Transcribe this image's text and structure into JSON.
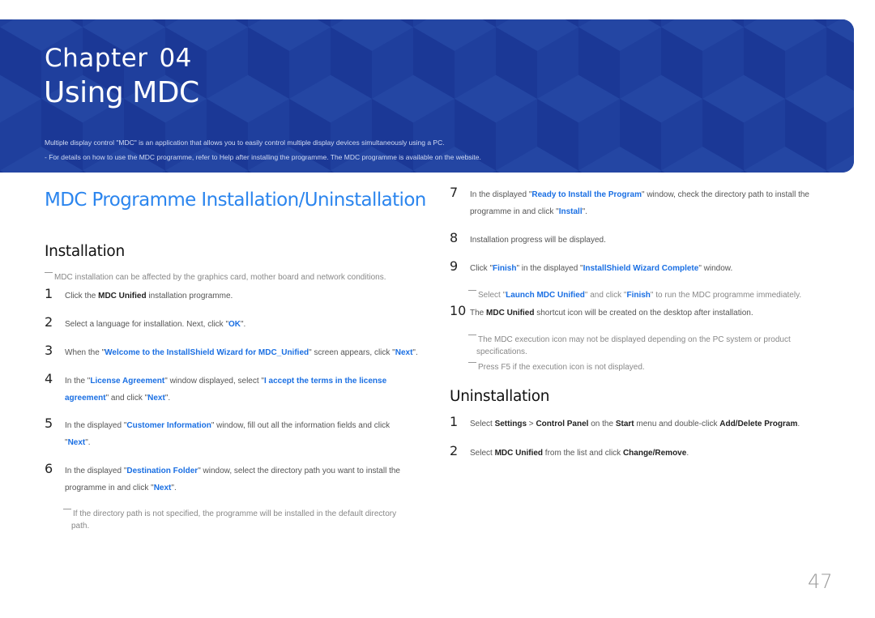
{
  "banner": {
    "chapter_label": "Chapter",
    "chapter_number": "04",
    "title": "Using MDC",
    "intro_line1": "Multiple display control \"MDC\" is an application that allows you to easily control multiple display devices simultaneously using a PC.",
    "intro_line2": "- For details on how to use the MDC programme, refer to Help after installing the programme. The MDC programme is available on the website."
  },
  "section_title": "MDC Programme Installation/Uninstallation",
  "installation": {
    "heading": "Installation",
    "note": "MDC installation can be affected by the graphics card, mother board and network conditions.",
    "steps": [
      {
        "num": "1",
        "parts": [
          "Click the ",
          "MDC Unified",
          " installation programme."
        ]
      },
      {
        "num": "2",
        "parts": [
          "Select a language for installation. Next, click \"",
          "OK",
          "\"."
        ]
      },
      {
        "num": "3",
        "parts": [
          "When the \"",
          "Welcome to the InstallShield Wizard for MDC_Unified",
          "\" screen appears, click \"",
          "Next",
          "\"."
        ]
      },
      {
        "num": "4",
        "parts": [
          "In the \"",
          "License Agreement",
          "\" window displayed, select \"",
          "I accept the terms in the license",
          "agreement",
          "\" and click \"",
          "Next",
          "\"."
        ]
      },
      {
        "num": "5",
        "parts": [
          "In the displayed \"",
          "Customer Information",
          "\" window, fill out all the information fields and click",
          "\"",
          "Next",
          "\"."
        ]
      },
      {
        "num": "6",
        "parts": [
          "In the displayed \"",
          "Destination Folder",
          "\" window, select the directory path you want to install the",
          "programme in and click \"",
          "Next",
          "\"."
        ]
      },
      {
        "num": "7",
        "parts": [
          "In the displayed \"",
          "Ready to Install the Program",
          "\" window, check the directory path to install the",
          "programme in and click \"",
          "Install",
          "\"."
        ]
      },
      {
        "num": "8",
        "parts": [
          "Installation progress will be displayed."
        ]
      },
      {
        "num": "9",
        "parts": [
          "Click \"",
          "Finish",
          "\" in the displayed \"",
          "InstallShield Wizard Complete",
          "\" window."
        ]
      },
      {
        "num": "10",
        "parts": [
          "The ",
          "MDC Unified",
          " shortcut icon will be created on the desktop after installation."
        ]
      }
    ],
    "note_step6_line1": "If the directory path is not specified, the programme will be installed in the default directory",
    "note_step6_line2": "path.",
    "note_step9": [
      "Select \"",
      "Launch MDC Unified",
      "\" and click \"",
      "Finish",
      "\" to run the MDC programme immediately."
    ],
    "note_step10a_line1": "The MDC execution icon may not be displayed depending on the PC system or product",
    "note_step10a_line2": "specifications.",
    "note_step10b": "Press F5 if the execution icon is not displayed."
  },
  "uninstallation": {
    "heading": "Uninstallation",
    "steps": [
      {
        "num": "1",
        "parts": [
          "Select ",
          "Settings",
          " > ",
          "Control Panel",
          " on the ",
          "Start",
          " menu and double-click ",
          "Add/Delete Program",
          "."
        ]
      },
      {
        "num": "2",
        "parts": [
          "Select ",
          "MDC Unified",
          " from the list and click ",
          "Change/Remove",
          "."
        ]
      }
    ]
  },
  "page_number": "47",
  "colors": {
    "banner": "#1f3f9d",
    "heading_blue": "#2b85ee",
    "link_blue": "#1a6fe3"
  }
}
